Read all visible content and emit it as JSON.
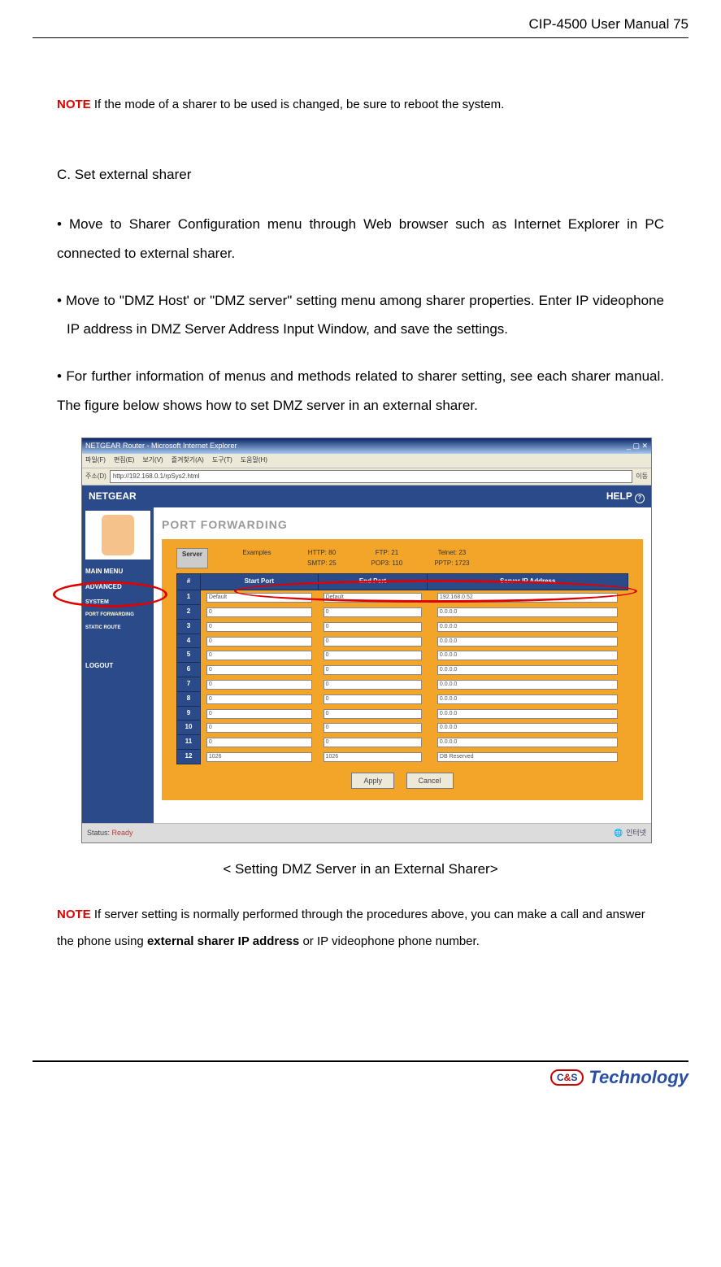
{
  "header": {
    "title": "CIP-4500 User Manual",
    "page": " 75"
  },
  "note1": {
    "label": "NOTE",
    "text": " If the mode of a sharer to be used is changed, be sure to reboot the system."
  },
  "sectionC": {
    "title": " C. Set external sharer"
  },
  "bullets": {
    "b1": "• Move to Sharer Configuration menu through Web browser such as Internet Explorer in PC connected to external sharer.",
    "b2": "• Move to \"DMZ Host' or \"DMZ server\" setting menu among sharer properties. Enter IP videophone IP address in DMZ Server Address Input Window, and save the settings.",
    "b3": "• For further information of menus and methods related to sharer setting, see each sharer manual. The figure below shows how to set DMZ server in an external sharer."
  },
  "browser": {
    "title": "NETGEAR Router - Microsoft Internet Explorer",
    "menus": [
      "파일(F)",
      "편집(E)",
      "보기(V)",
      "즐겨찾기(A)",
      "도구(T)",
      "도움말(H)"
    ],
    "addr_label": "주소(D)",
    "url": "http://192.168.0.1/rpSys2.html",
    "go": "이동"
  },
  "netgear": {
    "brand": "NETGEAR",
    "help": "HELP",
    "side": {
      "main": "MAIN MENU",
      "adv": "ADVANCED",
      "sys": "SYSTEM",
      "port": "PORT FORWARDING",
      "route": "STATIC ROUTE",
      "logout": "LOGOUT"
    },
    "pftitle": "PORT FORWARDING",
    "svc_tab": "Server",
    "ex_label": "Examples",
    "ex1a": "HTTP: 80",
    "ex1b": "SMTP: 25",
    "ex2a": "FTP: 21",
    "ex2b": "POP3: 110",
    "ex3a": "Telnet: 23",
    "ex3b": "PPTP: 1723",
    "th_num": "#",
    "th_sp": "Start Port",
    "th_ep": "End Port",
    "th_ip": "Server IP Address",
    "rows": [
      {
        "n": "1",
        "sp": "Default",
        "ep": "Default",
        "ip": "192.168.0.52"
      },
      {
        "n": "2",
        "sp": "0",
        "ep": "0",
        "ip": "0.0.0.0"
      },
      {
        "n": "3",
        "sp": "0",
        "ep": "0",
        "ip": "0.0.0.0"
      },
      {
        "n": "4",
        "sp": "0",
        "ep": "0",
        "ip": "0.0.0.0"
      },
      {
        "n": "5",
        "sp": "0",
        "ep": "0",
        "ip": "0.0.0.0"
      },
      {
        "n": "6",
        "sp": "0",
        "ep": "0",
        "ip": "0.0.0.0"
      },
      {
        "n": "7",
        "sp": "0",
        "ep": "0",
        "ip": "0.0.0.0"
      },
      {
        "n": "8",
        "sp": "0",
        "ep": "0",
        "ip": "0.0.0.0"
      },
      {
        "n": "9",
        "sp": "0",
        "ep": "0",
        "ip": "0.0.0.0"
      },
      {
        "n": "10",
        "sp": "0",
        "ep": "0",
        "ip": "0.0.0.0"
      },
      {
        "n": "11",
        "sp": "0",
        "ep": "0",
        "ip": "0.0.0.0"
      },
      {
        "n": "12",
        "sp": "1026",
        "ep": "1026",
        "ip": "DB Reserved"
      }
    ],
    "apply": "Apply",
    "cancel": "Cancel",
    "status_label": "Status:",
    "status_val": "Ready",
    "zone": "인터넷"
  },
  "caption": "< Setting DMZ Server in an External Sharer>",
  "note2": {
    "label": "NOTE",
    "pre": " If server setting is normally performed through the procedures above, you can make a call and answer the phone using ",
    "bold": "external sharer IP address",
    "post": " or IP videophone phone number."
  },
  "footer": {
    "badge_c": "C",
    "badge_amp": "&",
    "badge_s": "S",
    "text": "Technology"
  }
}
